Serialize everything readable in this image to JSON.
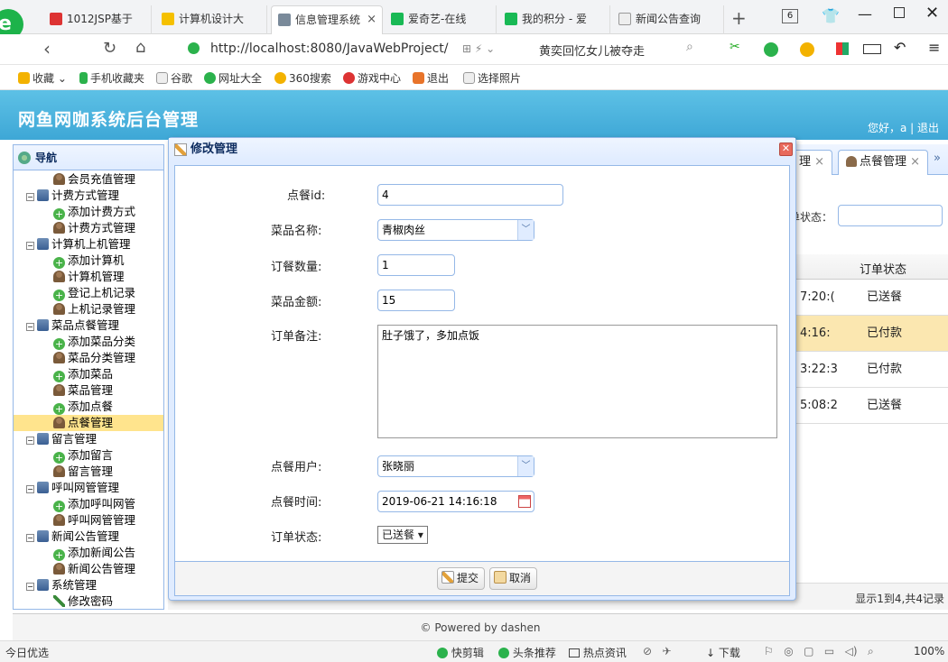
{
  "browser": {
    "tabs": [
      {
        "label": "1012JSP基于"
      },
      {
        "label": "计算机设计大"
      },
      {
        "label": "信息管理系统"
      },
      {
        "label": "爱奇艺-在线"
      },
      {
        "label": "我的积分 - 爱"
      },
      {
        "label": "新闻公告查询"
      }
    ],
    "new_tab": "+",
    "tab_count": "6",
    "url": "http://localhost:8080/JavaWebProject/",
    "search_text": "黄奕回忆女儿被夺走",
    "favorites": [
      "收藏",
      "手机收藏夹",
      "谷歌",
      "网址大全",
      "360搜索",
      "游戏中心",
      "退出",
      "选择照片"
    ]
  },
  "app": {
    "title": "网鱼网咖系统后台管理",
    "user_text": "您好，a | 退出",
    "footer": "© Powered by dashen"
  },
  "sidebar": {
    "header": "导航",
    "items": [
      {
        "label": "会员充值管理",
        "type": "user",
        "level": 2
      },
      {
        "label": "计费方式管理",
        "type": "folder",
        "level": 1
      },
      {
        "label": "添加计费方式",
        "type": "add",
        "level": 2
      },
      {
        "label": "计费方式管理",
        "type": "user",
        "level": 2
      },
      {
        "label": "计算机上机管理",
        "type": "folder",
        "level": 1
      },
      {
        "label": "添加计算机",
        "type": "add",
        "level": 2
      },
      {
        "label": "计算机管理",
        "type": "user",
        "level": 2
      },
      {
        "label": "登记上机记录",
        "type": "add",
        "level": 2
      },
      {
        "label": "上机记录管理",
        "type": "user",
        "level": 2
      },
      {
        "label": "菜品点餐管理",
        "type": "folder",
        "level": 1
      },
      {
        "label": "添加菜品分类",
        "type": "add",
        "level": 2
      },
      {
        "label": "菜品分类管理",
        "type": "user",
        "level": 2
      },
      {
        "label": "添加菜品",
        "type": "add",
        "level": 2
      },
      {
        "label": "菜品管理",
        "type": "user",
        "level": 2
      },
      {
        "label": "添加点餐",
        "type": "add",
        "level": 2
      },
      {
        "label": "点餐管理",
        "type": "user",
        "level": 2,
        "selected": true
      },
      {
        "label": "留言管理",
        "type": "folder",
        "level": 1
      },
      {
        "label": "添加留言",
        "type": "add",
        "level": 2
      },
      {
        "label": "留言管理",
        "type": "user",
        "level": 2
      },
      {
        "label": "呼叫网管管理",
        "type": "folder",
        "level": 1
      },
      {
        "label": "添加呼叫网管",
        "type": "add",
        "level": 2
      },
      {
        "label": "呼叫网管管理",
        "type": "user",
        "level": 2
      },
      {
        "label": "新闻公告管理",
        "type": "folder",
        "level": 1
      },
      {
        "label": "添加新闻公告",
        "type": "add",
        "level": 2
      },
      {
        "label": "新闻公告管理",
        "type": "user",
        "level": 2
      },
      {
        "label": "系统管理",
        "type": "folder",
        "level": 1
      },
      {
        "label": "修改密码",
        "type": "pen",
        "level": 2
      }
    ]
  },
  "main": {
    "tabs": [
      {
        "label": "理"
      },
      {
        "label": "点餐管理"
      }
    ],
    "filter_label": "单状态：",
    "grid_header": "订单状态",
    "rows": [
      {
        "time": "7:20:(",
        "status": "已送餐"
      },
      {
        "time": "4:16:",
        "status": "已付款"
      },
      {
        "time": "3:22:3",
        "status": "已付款"
      },
      {
        "time": "5:08:2",
        "status": "已送餐"
      }
    ],
    "pager_text": "显示1到4,共4记录"
  },
  "dialog": {
    "title": "修改管理",
    "fields": {
      "id_label": "点餐id:",
      "id_value": "4",
      "dish_label": "菜品名称:",
      "dish_value": "青椒肉丝",
      "qty_label": "订餐数量:",
      "qty_value": "1",
      "amount_label": "菜品金额:",
      "amount_value": "15",
      "memo_label": "订单备注:",
      "memo_value": "肚子饿了，多加点饭",
      "user_label": "点餐用户:",
      "user_value": "张晓丽",
      "time_label": "点餐时间:",
      "time_value": "2019-06-21 14:16:18",
      "status_label": "订单状态:",
      "status_value": "已送餐"
    },
    "submit": "提交",
    "cancel": "取消"
  },
  "statusbar": {
    "left": "今日优选",
    "items": [
      "快剪辑",
      "头条推荐",
      "热点资讯",
      "下载"
    ],
    "zoom": "100%"
  },
  "colors": {
    "header_blue": "#3ea7d6",
    "panel_border": "#95b8e7",
    "selected": "#ffe48d"
  }
}
